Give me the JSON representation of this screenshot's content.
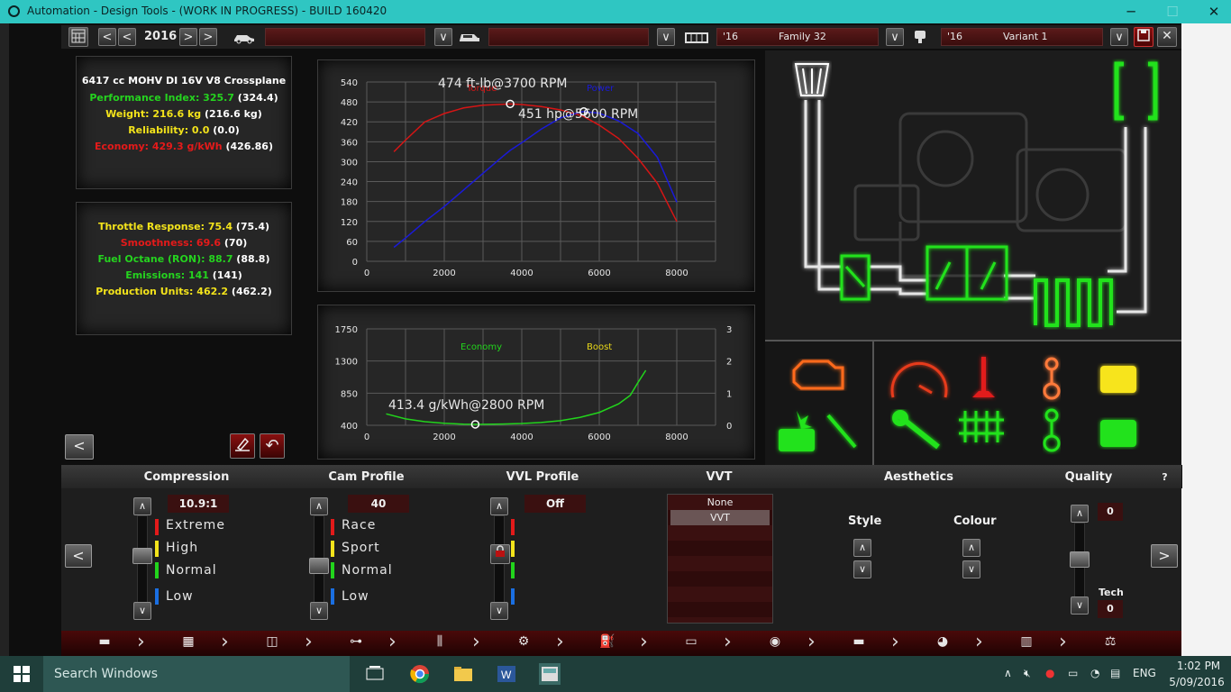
{
  "window": {
    "title": "Automation - Design Tools - (WORK IN PROGRESS) - BUILD 160420",
    "minimize": "─",
    "maximize": "☐",
    "close": "✕"
  },
  "toolbar": {
    "year": "2016",
    "family_year": "'16",
    "family_name": "Family 32",
    "variant_year": "'16",
    "variant_name": "Variant 1"
  },
  "stats": {
    "engine_name": "6417 cc MOHV DI 16V V8 Crossplane",
    "lines": [
      {
        "label": "Performance Index: 325.7",
        "extra": " (324.4)",
        "color": "green"
      },
      {
        "label": "Weight: 216.6 kg",
        "extra": " (216.6 kg)",
        "color": "yellow"
      },
      {
        "label": "Reliability: 0.0",
        "extra": " (0.0)",
        "color": "yellow"
      },
      {
        "label": "Economy: 429.3 g/kWh",
        "extra": " (426.86)",
        "color": "red"
      }
    ],
    "lines2": [
      {
        "label": "Throttle Response: 75.4",
        "extra": " (75.4)",
        "color": "yellow"
      },
      {
        "label": "Smoothness: 69.6",
        "extra": " (70)",
        "color": "red"
      },
      {
        "label": "Fuel Octane (RON): 88.7",
        "extra": " (88.8)",
        "color": "green"
      },
      {
        "label": "Emissions: 141",
        "extra": " (141)",
        "color": "green"
      },
      {
        "label": "Production Units: 462.2",
        "extra": " (462.2)",
        "color": "yellow"
      }
    ]
  },
  "chart_data": [
    {
      "type": "line",
      "x": [
        700,
        1000,
        1500,
        2000,
        2500,
        3000,
        3500,
        3700,
        4000,
        4500,
        5000,
        5500,
        5600,
        6000,
        6500,
        7000,
        7500,
        8000
      ],
      "series": [
        {
          "name": "Torque",
          "color": "#d61515",
          "values": [
            330,
            365,
            420,
            445,
            462,
            470,
            473,
            474,
            472,
            466,
            456,
            440,
            436,
            410,
            370,
            310,
            235,
            120
          ]
        },
        {
          "name": "Power",
          "color": "#1a1ad8",
          "values": [
            42,
            70,
            120,
            165,
            215,
            265,
            315,
            334,
            357,
            398,
            432,
            449,
            451,
            446,
            423,
            385,
            313,
            178
          ]
        }
      ],
      "ylim": [
        0,
        540
      ],
      "xlim": [
        0,
        9000
      ],
      "yticks": [
        "540",
        "480",
        "420",
        "360",
        "300",
        "240",
        "180",
        "120",
        "60",
        "0"
      ],
      "xticks": [
        "0",
        "2000",
        "4000",
        "6000",
        "8000"
      ],
      "annotations": [
        "474 ft-lb@3700 RPM",
        "451 hp@5600 RPM"
      ],
      "grid": true
    },
    {
      "type": "line",
      "x": [
        500,
        1000,
        1500,
        2000,
        2500,
        2800,
        3500,
        4000,
        4500,
        5000,
        5500,
        6000,
        6500,
        6800,
        7000,
        7200
      ],
      "series": [
        {
          "name": "Economy",
          "color": "#22d41c",
          "values": [
            560,
            490,
            450,
            428,
            416,
            413.4,
            418,
            425,
            440,
            465,
            510,
            580,
            700,
            820,
            1000,
            1170
          ]
        },
        {
          "name": "Boost",
          "color": "#e9d819",
          "values": []
        }
      ],
      "ylim": [
        400,
        1750
      ],
      "y2lim": [
        0,
        3
      ],
      "xlim": [
        0,
        9000
      ],
      "yticks": [
        "1750",
        "1300",
        "850",
        "400"
      ],
      "y2ticks": [
        "3",
        "2",
        "1",
        "0"
      ],
      "xticks": [
        "0",
        "2000",
        "4000",
        "6000",
        "8000"
      ],
      "annotations": [
        "413.4 g/kWh@2800 RPM"
      ],
      "grid": true
    }
  ],
  "bottom": {
    "headers": [
      "Compression",
      "Cam Profile",
      "VVL Profile",
      "VVT",
      "Aesthetics",
      "Quality",
      "?"
    ],
    "compression": {
      "value": "10.9:1",
      "levels": [
        "Extreme",
        "High",
        "Normal",
        "Low"
      ]
    },
    "cam": {
      "value": "40",
      "levels": [
        "Race",
        "Sport",
        "Normal",
        "Low"
      ]
    },
    "vvl": {
      "value": "Off"
    },
    "vvt": {
      "options": [
        "None",
        "VVT"
      ],
      "selected": "VVT"
    },
    "aesthetics": {
      "style": "Style",
      "colour": "Colour"
    },
    "quality": {
      "value": "0",
      "tech_label": "Tech",
      "tech_value": "0"
    }
  },
  "taskbar": {
    "search_placeholder": "Search Windows",
    "lang": "ENG",
    "time": "1:02 PM",
    "date": "5/09/2016"
  },
  "colors": {
    "accent_green": "#22e21a",
    "torque": "#d61515",
    "power": "#1a1ad8",
    "taskbar": "#1f3e3a",
    "titlebar": "#2fc6c2"
  }
}
